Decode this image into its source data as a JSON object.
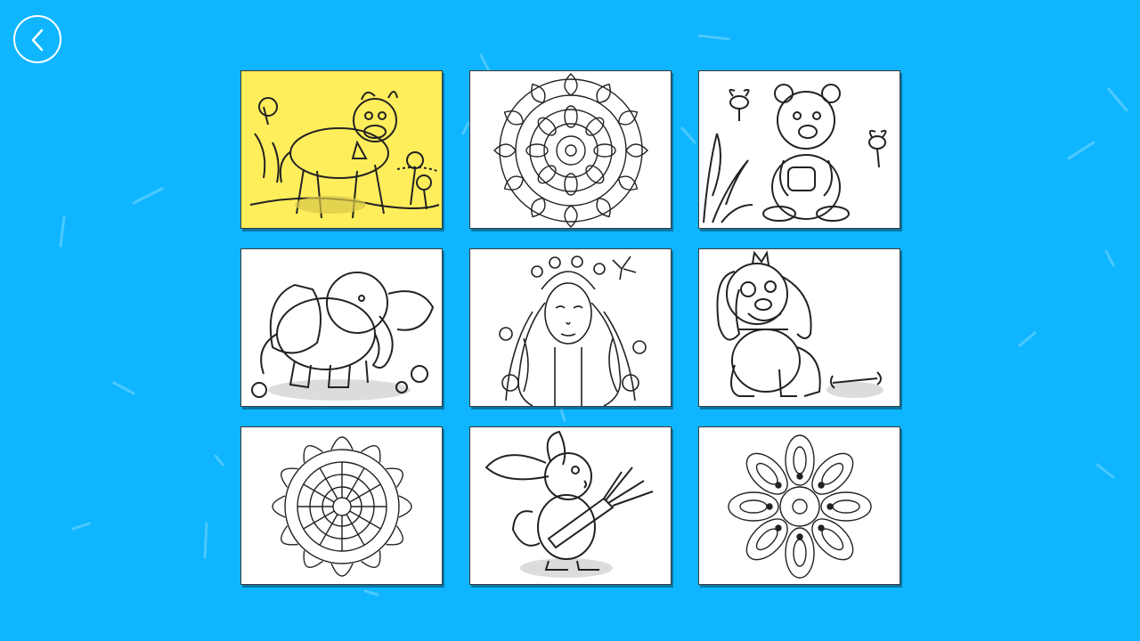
{
  "back_button": {
    "icon": "chevron-left-icon",
    "color": "#ffffff"
  },
  "theme": {
    "background": "#0fb6ff",
    "selected_card": "#ffee5c",
    "card": "#ffffff",
    "line": "#222222"
  },
  "gallery": {
    "selected_index": 0,
    "items": [
      {
        "subject": "calf-with-bell"
      },
      {
        "subject": "flower-mandala"
      },
      {
        "subject": "bear-with-honey-pot-and-bees"
      },
      {
        "subject": "baby-elephant-with-flowers"
      },
      {
        "subject": "girl-with-floral-hair"
      },
      {
        "subject": "floppy-eared-puppy-with-bone"
      },
      {
        "subject": "petal-mandala"
      },
      {
        "subject": "bunny-with-carrot"
      },
      {
        "subject": "ornate-mandala"
      }
    ]
  }
}
